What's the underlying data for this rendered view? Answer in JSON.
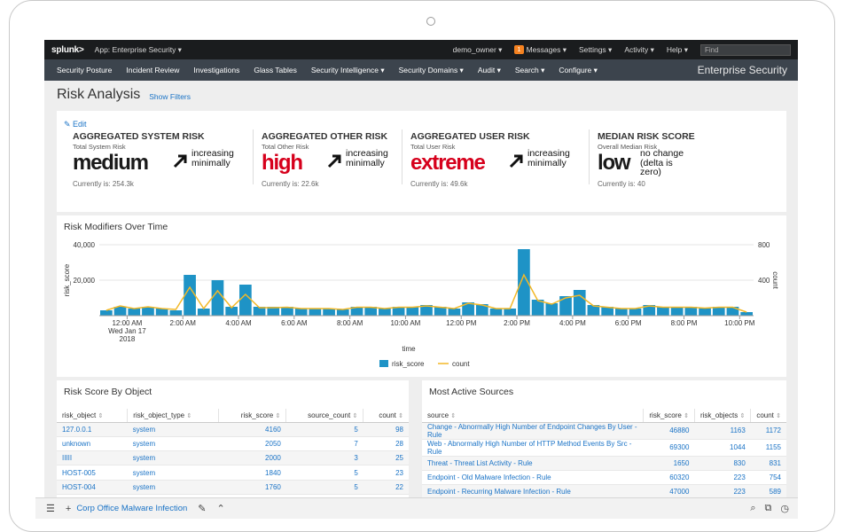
{
  "topbar": {
    "logo": "splunk>",
    "app": "App: Enterprise Security ▾",
    "user": "demo_owner ▾",
    "messages_count": "1",
    "messages": "Messages ▾",
    "settings": "Settings ▾",
    "activity": "Activity ▾",
    "help": "Help ▾",
    "find_placeholder": "Find"
  },
  "navbar": {
    "items": [
      "Security Posture",
      "Incident Review",
      "Investigations",
      "Glass Tables",
      "Security Intelligence ▾",
      "Security Domains ▾",
      "Audit ▾",
      "Search ▾",
      "Configure ▾"
    ],
    "brand": "Enterprise Security"
  },
  "page": {
    "title": "Risk Analysis",
    "show_filters": "Show Filters"
  },
  "kpis": {
    "edit": "✎ Edit",
    "items": [
      {
        "title": "AGGREGATED SYSTEM RISK",
        "subtitle": "Total System Risk",
        "value": "medium",
        "color": "#1a1a1a",
        "trend1": "increasing",
        "trend2": "minimally",
        "current": "Currently is: 254.3k"
      },
      {
        "title": "AGGREGATED OTHER RISK",
        "subtitle": "Total Other Risk",
        "value": "high",
        "color": "#d6001c",
        "trend1": "increasing",
        "trend2": "minimally",
        "current": "Currently is: 22.6k"
      },
      {
        "title": "AGGREGATED USER RISK",
        "subtitle": "Total User Risk",
        "value": "extreme",
        "color": "#d6001c",
        "trend1": "increasing",
        "trend2": "minimally",
        "current": "Currently is: 49.6k"
      },
      {
        "title": "MEDIAN RISK SCORE",
        "subtitle": "Overall Median Risk",
        "value": "low",
        "color": "#1a1a1a",
        "trend1": "no change",
        "trend2": "(delta is zero)",
        "current": "Currently is: 40"
      }
    ]
  },
  "chart_data": {
    "type": "bar",
    "title": "Risk Modifiers Over Time",
    "xlabel": "time",
    "ylabel": "risk_score",
    "y2label": "count",
    "ylim": [
      0,
      40000
    ],
    "y2lim": [
      0,
      800
    ],
    "yticks": [
      "40,000",
      "20,000"
    ],
    "y2ticks": [
      "800",
      "400"
    ],
    "xticks": [
      {
        "label": "12:00 AM",
        "sub1": "Wed Jan 17",
        "sub2": "2018",
        "index": 2
      },
      {
        "label": "2:00 AM",
        "index": 6
      },
      {
        "label": "4:00 AM",
        "index": 10
      },
      {
        "label": "6:00 AM",
        "index": 14
      },
      {
        "label": "8:00 AM",
        "index": 18
      },
      {
        "label": "10:00 AM",
        "index": 22
      },
      {
        "label": "12:00 PM",
        "index": 26
      },
      {
        "label": "2:00 PM",
        "index": 30
      },
      {
        "label": "4:00 PM",
        "index": 34
      },
      {
        "label": "6:00 PM",
        "index": 38
      },
      {
        "label": "8:00 PM",
        "index": 42
      },
      {
        "label": "10:00 PM",
        "index": 46
      }
    ],
    "series": [
      {
        "name": "risk_score",
        "color": "#1e93c6",
        "values": [
          3000,
          5000,
          4000,
          5000,
          4000,
          3000,
          23000,
          4000,
          20000,
          5000,
          17500,
          5000,
          5000,
          5000,
          4000,
          4000,
          4000,
          3500,
          5000,
          5000,
          4000,
          5000,
          5000,
          6000,
          5000,
          4000,
          7500,
          6500,
          4000,
          4000,
          37500,
          9000,
          7000,
          11000,
          14500,
          6000,
          5000,
          4000,
          4000,
          6000,
          5000,
          5000,
          5000,
          4500,
          5000,
          5000,
          2000
        ]
      },
      {
        "name": "count",
        "color": "#f2b827",
        "values": [
          60,
          110,
          80,
          100,
          80,
          70,
          320,
          80,
          280,
          90,
          240,
          90,
          90,
          95,
          80,
          80,
          80,
          70,
          95,
          95,
          80,
          95,
          95,
          110,
          95,
          80,
          140,
          120,
          80,
          80,
          460,
          170,
          130,
          200,
          230,
          110,
          95,
          80,
          80,
          110,
          95,
          95,
          95,
          85,
          95,
          95,
          40
        ]
      }
    ],
    "legend": [
      "risk_score",
      "count"
    ],
    "legend_position": "bottom"
  },
  "left_table": {
    "title": "Risk Score By Object",
    "columns": [
      "risk_object",
      "risk_object_type",
      "risk_score",
      "source_count",
      "count"
    ],
    "rows": [
      [
        "127.0.0.1",
        "system",
        "4160",
        "5",
        "98"
      ],
      [
        "unknown",
        "system",
        "2050",
        "7",
        "28"
      ],
      [
        "IIIII",
        "system",
        "2000",
        "3",
        "25"
      ],
      [
        "HOST-005",
        "system",
        "1840",
        "5",
        "23"
      ],
      [
        "HOST-004",
        "system",
        "1760",
        "5",
        "22"
      ]
    ]
  },
  "right_table": {
    "title": "Most Active Sources",
    "columns": [
      "source",
      "risk_score",
      "risk_objects",
      "count"
    ],
    "rows": [
      [
        "Change - Abnormally High Number of Endpoint Changes By User - Rule",
        "46880",
        "1163",
        "1172"
      ],
      [
        "Web - Abnormally High Number of HTTP Method Events By Src - Rule",
        "69300",
        "1044",
        "1155"
      ],
      [
        "Threat - Threat List Activity - Rule",
        "1650",
        "830",
        "831"
      ],
      [
        "Endpoint - Old Malware Infection - Rule",
        "60320",
        "223",
        "754"
      ],
      [
        "Endpoint - Recurring Malware Infection - Rule",
        "47000",
        "223",
        "589"
      ]
    ]
  },
  "bottombar": {
    "title": "Corp Office Malware Infection"
  }
}
